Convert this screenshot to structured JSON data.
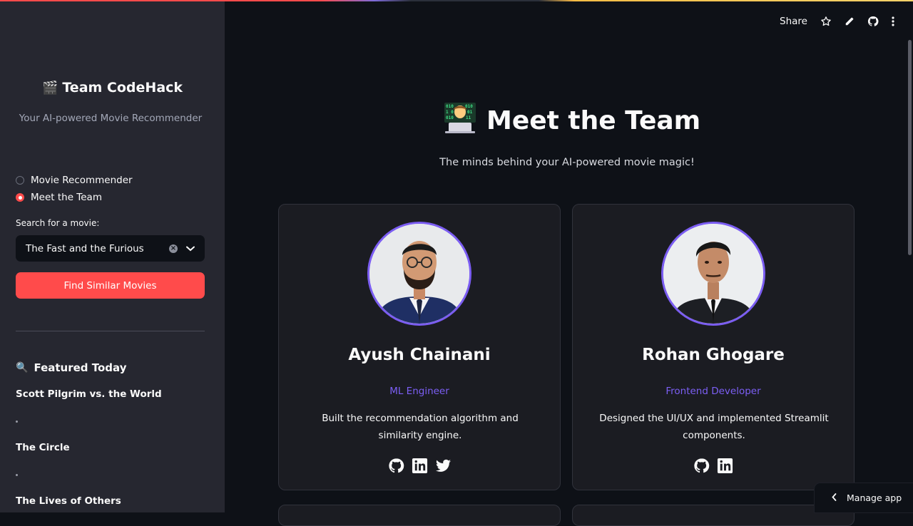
{
  "sidebar": {
    "title_emoji": "🎬",
    "title": "Team CodeHack",
    "subtitle": "Your AI-powered Movie Recommender",
    "nav": [
      {
        "label": "Movie Recommender",
        "selected": false
      },
      {
        "label": "Meet the Team",
        "selected": true
      }
    ],
    "search_label": "Search for a movie:",
    "search_value": "The Fast and the Furious",
    "find_button": "Find Similar Movies",
    "featured_emoji": "🔍",
    "featured_title": "Featured Today",
    "featured_movies": [
      "Scott Pilgrim vs. the World",
      "The Circle",
      "The Lives of Others"
    ]
  },
  "header": {
    "share_label": "Share",
    "icons": [
      "star-icon",
      "pencil-icon",
      "github-icon",
      "more-icon"
    ]
  },
  "main": {
    "title_emoji": "🧑‍💻",
    "title": "Meet the Team",
    "subtitle": "The minds behind your AI-powered movie magic!",
    "team": [
      {
        "name": "Ayush Chainani",
        "role": "ML Engineer",
        "description": "Built the recommendation algorithm and similarity engine.",
        "socials": [
          "github-icon",
          "linkedin-icon",
          "twitter-icon"
        ]
      },
      {
        "name": "Rohan Ghogare",
        "role": "Frontend Developer",
        "description": "Designed the UI/UX and implemented Streamlit components.",
        "socials": [
          "github-icon",
          "linkedin-icon"
        ]
      }
    ]
  },
  "footer": {
    "manage_app": "Manage app"
  },
  "colors": {
    "background": "#0e1117",
    "sidebar": "#262730",
    "primary": "#ff4b4b",
    "accent_purple": "#7c5ff5",
    "card": "#1b1c22"
  }
}
